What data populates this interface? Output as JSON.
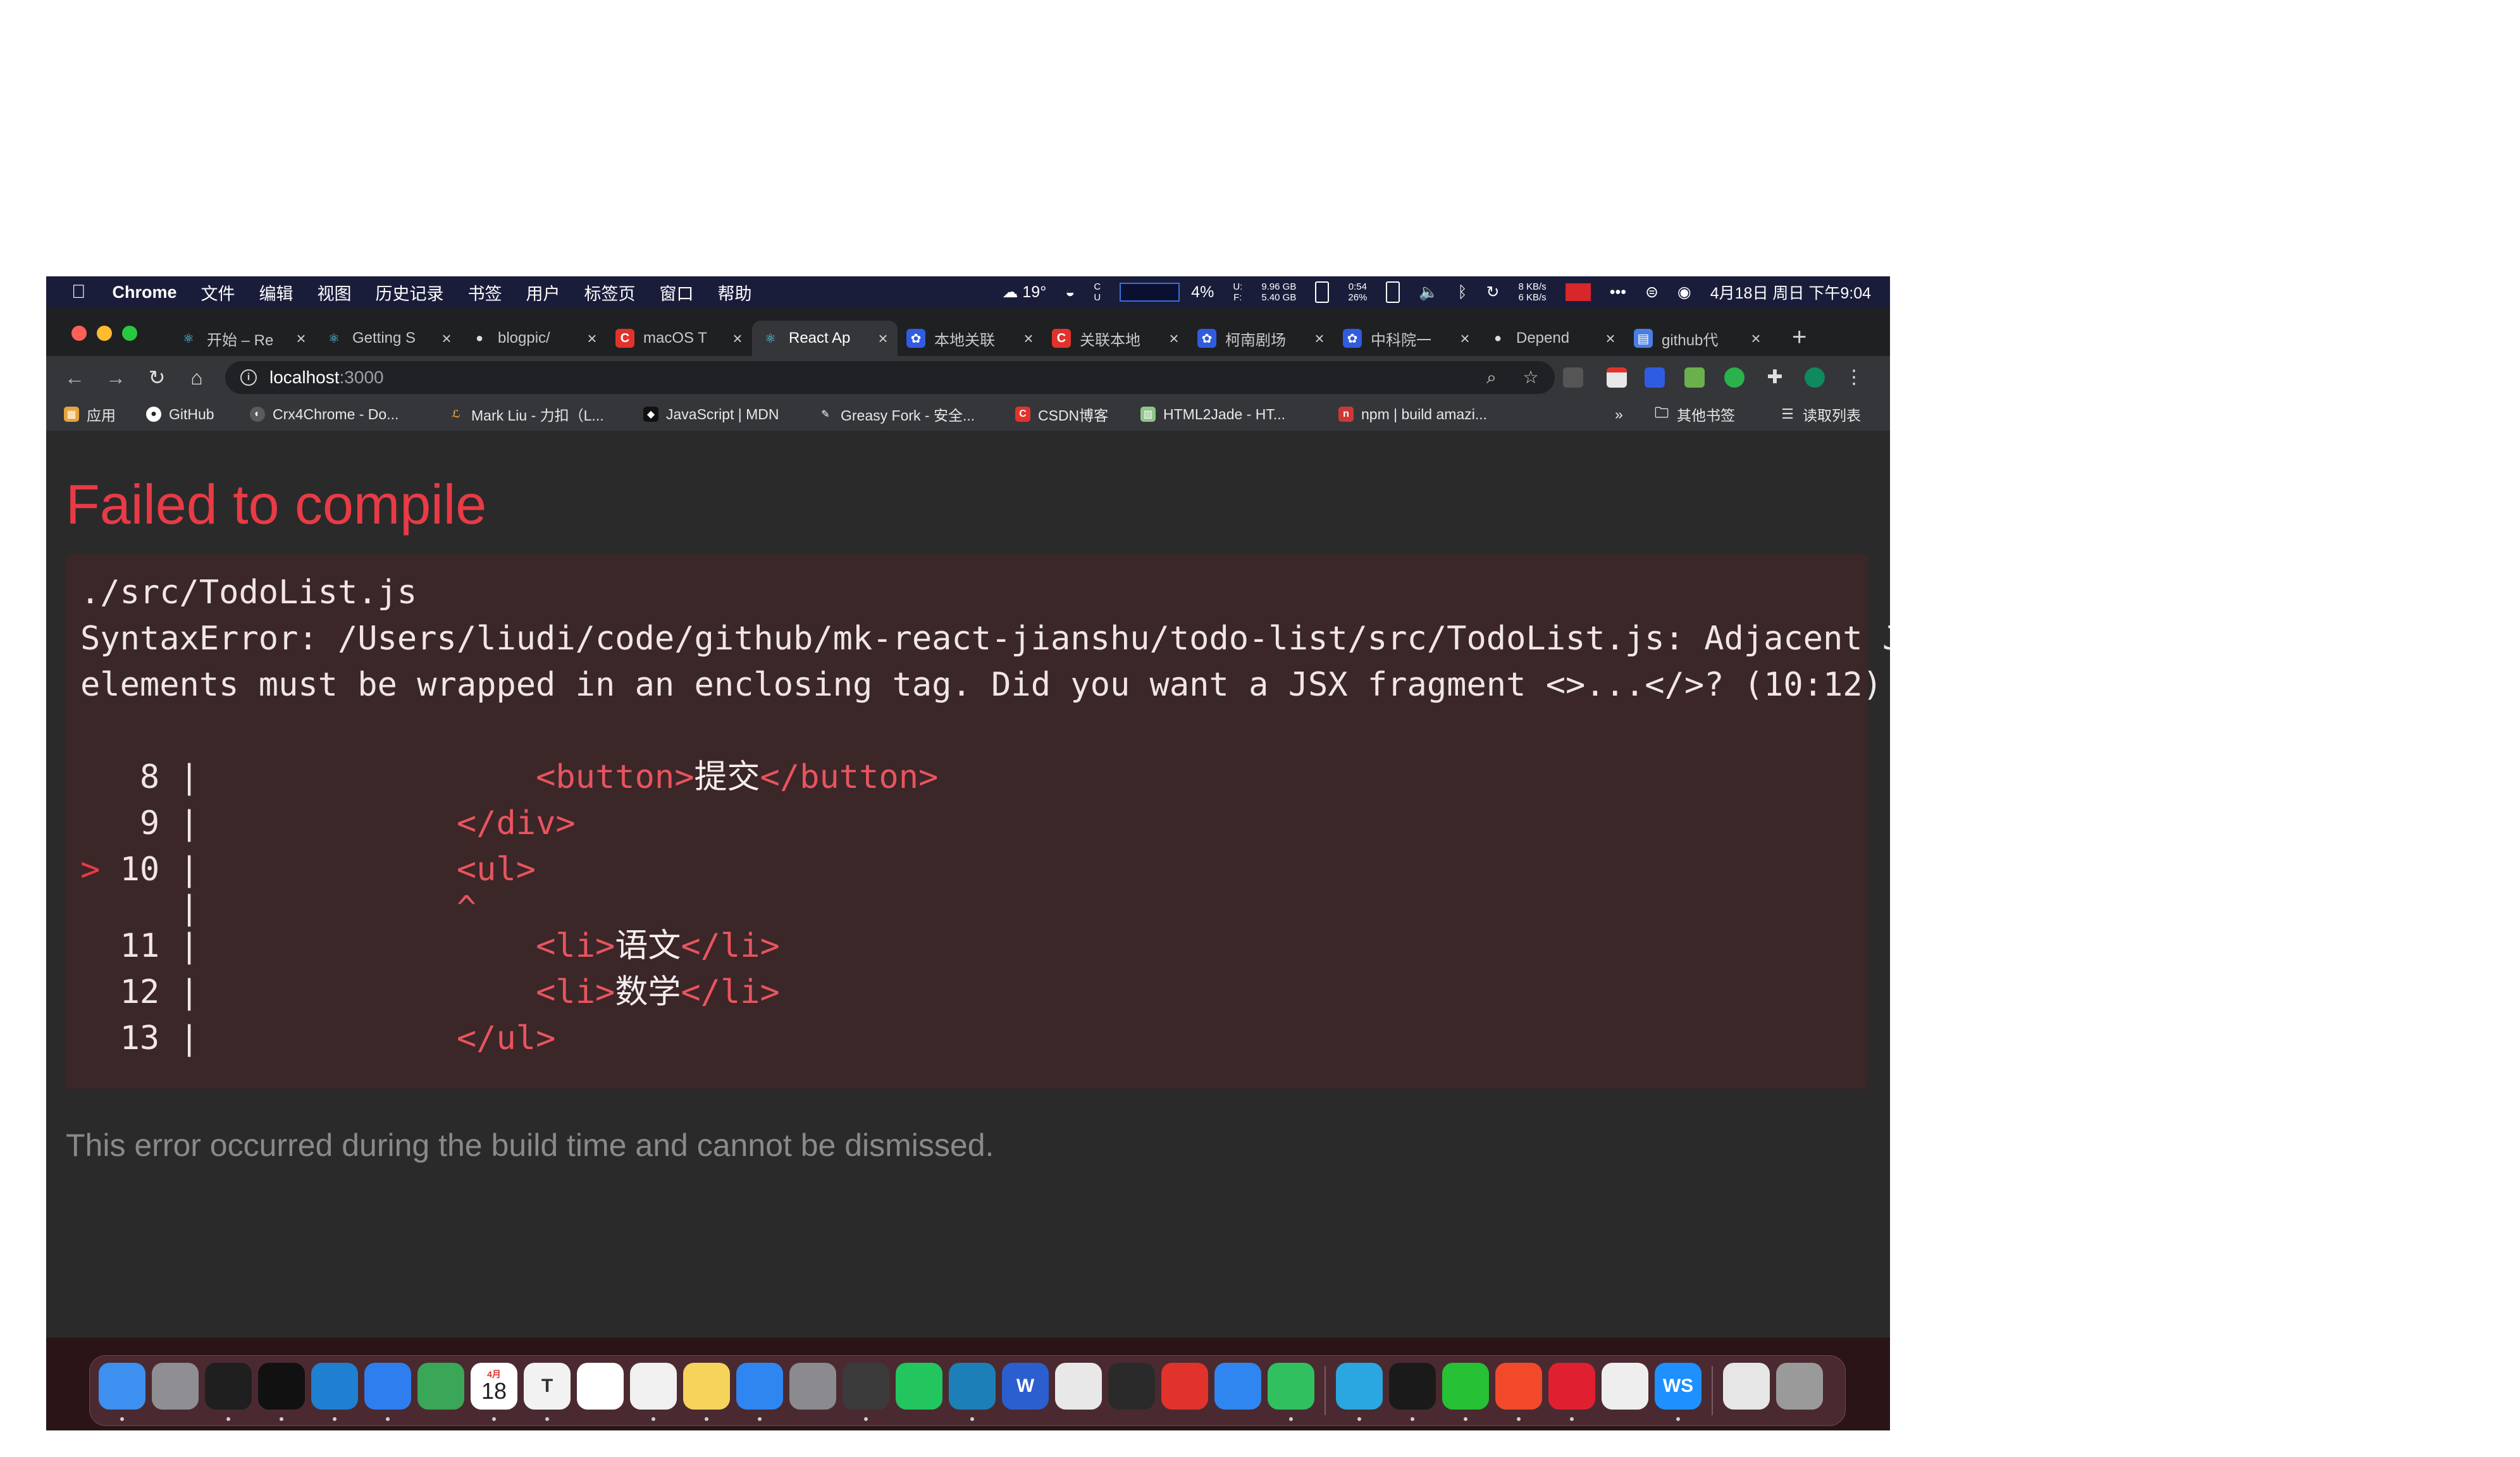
{
  "menubar": {
    "app_name": "Chrome",
    "menus": [
      "文件",
      "编辑",
      "视图",
      "历史记录",
      "书签",
      "用户",
      "标签页",
      "窗口",
      "帮助"
    ],
    "weather": "19°",
    "cpu": "4%",
    "mem_u": "9.96 GB",
    "mem_f": "5.40 GB",
    "battery_time": "0:54",
    "battery_pct": "26%",
    "net_up": "8 KB/s",
    "net_down": "6 KB/s",
    "datetime": "4月18日 周日 下午9:04"
  },
  "tabs": [
    {
      "title": "开始 – Re",
      "icon": "react-icon",
      "color": "#35363a"
    },
    {
      "title": "Getting S",
      "icon": "react-icon",
      "color": "#35363a"
    },
    {
      "title": "blogpic/",
      "icon": "github-icon",
      "color": "#35363a"
    },
    {
      "title": "macOS T",
      "icon": "csdn-icon",
      "color": "#e1332c"
    },
    {
      "title": "React Ap",
      "icon": "react-icon",
      "color": "#35363a"
    },
    {
      "title": "本地关联",
      "icon": "baidu-icon",
      "color": "#2f5ce0"
    },
    {
      "title": "关联本地",
      "icon": "csdn-icon",
      "color": "#e1332c"
    },
    {
      "title": "柯南剧场",
      "icon": "baidu-icon",
      "color": "#2f5ce0"
    },
    {
      "title": "中科院一",
      "icon": "baidu-icon",
      "color": "#2f5ce0"
    },
    {
      "title": "Depend",
      "icon": "github-icon",
      "color": "#35363a"
    },
    {
      "title": "github代",
      "icon": "doc-icon",
      "color": "#4a7ee6"
    }
  ],
  "address": {
    "host": "localhost",
    "port": ":3000"
  },
  "bookmarks": [
    {
      "label": "应用",
      "icon": "apps-grid-icon",
      "color": "#e8a33c"
    },
    {
      "label": "GitHub",
      "icon": "github-icon",
      "color": "#35363a"
    },
    {
      "label": "Crx4Chrome - Do...",
      "icon": "crx-icon",
      "color": "#5b5b5b"
    },
    {
      "label": "Mark Liu - 力扣（L...",
      "icon": "leetcode-icon",
      "color": "#f0a03a"
    },
    {
      "label": "JavaScript | MDN",
      "icon": "mdn-icon",
      "color": "#111111"
    },
    {
      "label": "Greasy Fork - 安全...",
      "icon": "greasyfork-icon",
      "color": "#5b5b5b"
    },
    {
      "label": "CSDN博客",
      "icon": "csdn-icon",
      "color": "#e1332c"
    },
    {
      "label": "HTML2Jade - HT...",
      "icon": "html2jade-icon",
      "color": "#8fc48a"
    },
    {
      "label": "npm | build amazi...",
      "icon": "npm-icon",
      "color": "#cb3837"
    }
  ],
  "bookmarks_more": "»",
  "other_bookmarks": "其他书签",
  "reading_list": "读取列表",
  "error": {
    "title": "Failed to compile",
    "file": "./src/TodoList.js",
    "message_line1": "SyntaxError: /Users/liudi/code/github/mk-react-jianshu/todo-list/src/TodoList.js: Adjacent JSX",
    "message_line2": "elements must be wrapped in an enclosing tag. Did you want a JSX fragment <>...</>? (10:12)",
    "code": [
      {
        "marker": "  ",
        "num": " 8",
        "indent": "                ",
        "open": "<button>",
        "text": "提交",
        "close": "</button>"
      },
      {
        "marker": "  ",
        "num": " 9",
        "indent": "            ",
        "open": "</div>",
        "text": "",
        "close": ""
      },
      {
        "marker": "> ",
        "num": "10",
        "indent": "            ",
        "open": "<ul>",
        "text": "",
        "close": ""
      },
      {
        "marker": "  ",
        "num": "  ",
        "indent": "            ",
        "open": "^",
        "text": "",
        "close": ""
      },
      {
        "marker": "  ",
        "num": "11",
        "indent": "                ",
        "open": "<li>",
        "text": "语文",
        "close": "</li>"
      },
      {
        "marker": "  ",
        "num": "12",
        "indent": "                ",
        "open": "<li>",
        "text": "数学",
        "close": "</li>"
      },
      {
        "marker": "  ",
        "num": "13",
        "indent": "            ",
        "open": "</ul>",
        "text": "",
        "close": ""
      }
    ],
    "footer": "This error occurred during the build time and cannot be dismissed."
  },
  "dock": {
    "calendar_month": "4月",
    "calendar_day": "18",
    "apps": [
      {
        "name": "finder",
        "color": "#3d8ff0",
        "label": "",
        "running": true
      },
      {
        "name": "launchpad",
        "color": "#8e8e93",
        "label": "",
        "running": false
      },
      {
        "name": "activity-monitor",
        "color": "#1f1f1f",
        "label": "",
        "running": true
      },
      {
        "name": "terminal",
        "color": "#111111",
        "label": "",
        "running": true
      },
      {
        "name": "vscode",
        "color": "#1f7fd0",
        "label": "",
        "running": true
      },
      {
        "name": "safari",
        "color": "#2f7ef0",
        "label": "",
        "running": true
      },
      {
        "name": "telegram",
        "color": "#3aa657",
        "label": "",
        "running": false
      },
      {
        "name": "calendar",
        "color": "#ffffff",
        "label": "",
        "running": true
      },
      {
        "name": "typora",
        "color": "#f2f2f2",
        "label": "T",
        "running": true
      },
      {
        "name": "reminders",
        "color": "#ffffff",
        "label": "",
        "running": false
      },
      {
        "name": "chrome",
        "color": "#f0f0f0",
        "label": "",
        "running": true
      },
      {
        "name": "notes",
        "color": "#f6d35a",
        "label": "",
        "running": true
      },
      {
        "name": "app-store",
        "color": "#2f86f0",
        "label": "",
        "running": true
      },
      {
        "name": "system-preferences",
        "color": "#8a8a8f",
        "label": "",
        "running": false
      },
      {
        "name": "qq",
        "color": "#3b3b3b",
        "label": "",
        "running": true
      },
      {
        "name": "wechat",
        "color": "#22c55e",
        "label": "",
        "running": false
      },
      {
        "name": "edge",
        "color": "#1d7fb8",
        "label": "",
        "running": true
      },
      {
        "name": "word",
        "color": "#2b5fd0",
        "label": "W",
        "running": false
      },
      {
        "name": "screen-recorder",
        "color": "#e8e8e8",
        "label": "",
        "running": false
      },
      {
        "name": "cloud-app",
        "color": "#2a2a2a",
        "label": "",
        "running": false
      },
      {
        "name": "xmind",
        "color": "#e1332c",
        "label": "",
        "running": false
      },
      {
        "name": "upload-app",
        "color": "#2f86f0",
        "label": "",
        "running": false
      },
      {
        "name": "panda-app",
        "color": "#30c060",
        "label": "",
        "running": true
      },
      {
        "name": "sep",
        "color": "",
        "label": "",
        "running": false
      },
      {
        "name": "transfer-app",
        "color": "#2aa6e0",
        "label": "",
        "running": true
      },
      {
        "name": "iterm",
        "color": "#1a1a1a",
        "label": "",
        "running": true
      },
      {
        "name": "iqiyi",
        "color": "#26c135",
        "label": "",
        "running": true
      },
      {
        "name": "mail-app",
        "color": "#f2492b",
        "label": "",
        "running": true
      },
      {
        "name": "pdf-app",
        "color": "#e02030",
        "label": "",
        "running": true
      },
      {
        "name": "textedit",
        "color": "#eeeeee",
        "label": "",
        "running": false
      },
      {
        "name": "webstorm",
        "color": "#1e90ff",
        "label": "WS",
        "running": true
      },
      {
        "name": "sep",
        "color": "",
        "label": "",
        "running": false
      },
      {
        "name": "document",
        "color": "#e6e6e6",
        "label": "",
        "running": false
      },
      {
        "name": "trash",
        "color": "#9a9a9a",
        "label": "",
        "running": false
      }
    ]
  }
}
